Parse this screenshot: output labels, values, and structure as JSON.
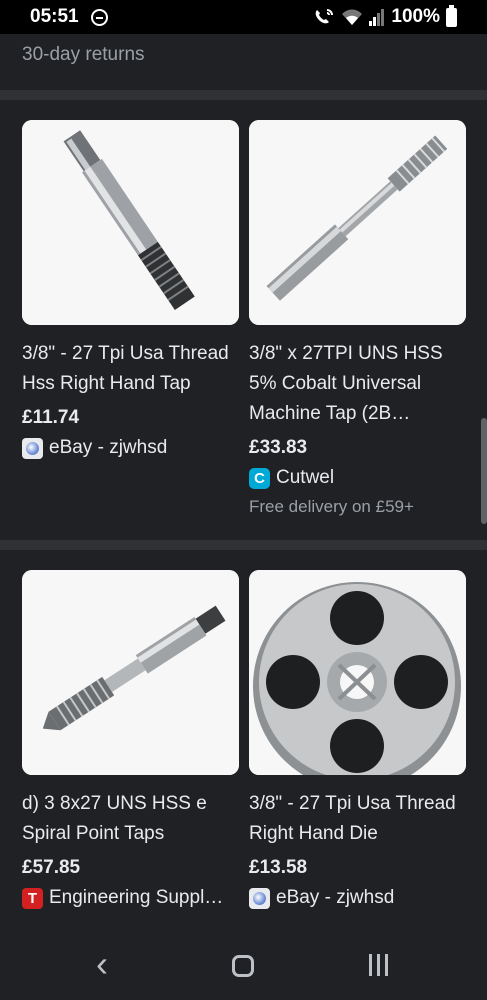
{
  "status_bar": {
    "time": "05:51",
    "battery": "100%",
    "icons": [
      "do-not-disturb-icon",
      "wifi-calling-icon",
      "wifi-icon",
      "signal-icon",
      "battery-icon"
    ]
  },
  "previous_result": {
    "returns_text": "30-day returns"
  },
  "products": [
    {
      "title": "3/8\" - 27 Tpi Usa Thread Hss Right Hand Tap",
      "price": "£11.74",
      "seller": "eBay - zjwhsd",
      "seller_icon": "ebay-icon",
      "delivery": ""
    },
    {
      "title": "3/8\" x 27TPI UNS HSS 5% Cobalt Universal Machine Tap (2B…",
      "price": "£33.83",
      "seller": "Cutwel",
      "seller_icon": "cutwel-icon",
      "delivery": "Free delivery on £59+"
    },
    {
      "title": "d) 3 8x27 UNS HSS e Spiral Point Taps",
      "price": "£57.85",
      "seller": "Engineering Suppl…",
      "seller_icon": "engineering-supplies-icon",
      "delivery": ""
    },
    {
      "title": "3/8\" - 27 Tpi Usa Thread Right Hand Die",
      "price": "£13.58",
      "seller": "eBay - zjwhsd",
      "seller_icon": "ebay-icon",
      "delivery": ""
    }
  ],
  "favicon_letters": {
    "cutwel": "C",
    "engineering_supplies": "T"
  },
  "colors": {
    "background": "#202124",
    "divider": "#303134",
    "text_primary": "#e8eaed",
    "text_secondary": "#9aa0a6",
    "cutwel_brand": "#00a9d6",
    "engineering_supplies_brand": "#d32020"
  },
  "nav_bar": {
    "back_icon": "back-icon",
    "home_icon": "home-icon",
    "recents_icon": "recents-icon"
  }
}
